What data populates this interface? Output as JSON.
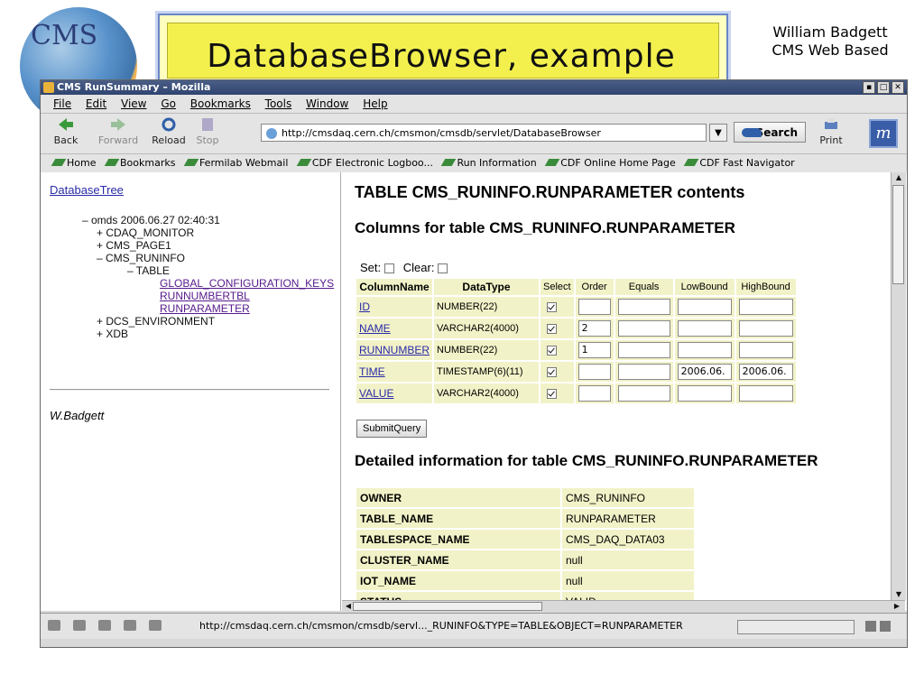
{
  "slide": {
    "title": "DatabaseBrowser, example",
    "author_line1": "William Badgett",
    "author_line2": "CMS Web Based",
    "logo_text": "CMS"
  },
  "window": {
    "title": "CMS RunSummary – Mozilla",
    "menu": [
      "File",
      "Edit",
      "View",
      "Go",
      "Bookmarks",
      "Tools",
      "Window",
      "Help"
    ],
    "nav": {
      "back": "Back",
      "forward": "Forward",
      "reload": "Reload",
      "stop": "Stop",
      "search": "Search",
      "print": "Print"
    },
    "url": "http://cmsdaq.cern.ch/cmsmon/cmsdb/servlet/DatabaseBrowser",
    "bookmarks": [
      "Home",
      "Bookmarks",
      "Fermilab Webmail",
      "CDF Electronic Logboo...",
      "Run Information",
      "CDF Online Home Page",
      "CDF Fast Navigator"
    ],
    "status_url": "http://cmsdaq.cern.ch/cmsmon/cmsdb/servl..._RUNINFO&TYPE=TABLE&OBJECT=RUNPARAMETER"
  },
  "left": {
    "tree_link": "DatabaseTree",
    "tree": {
      "root": "– omds 2006.06.27 02:40:31",
      "n1": "+ CDAQ_MONITOR",
      "n2": "+ CMS_PAGE1",
      "n3": "– CMS_RUNINFO",
      "n4": "– TABLE",
      "l1": "GLOBAL_CONFIGURATION_KEYS",
      "l2": "RUNNUMBERTBL",
      "l3": "RUNPARAMETER",
      "n5": "+ DCS_ENVIRONMENT",
      "n6": "+ XDB"
    },
    "signature": "W.Badgett"
  },
  "main": {
    "heading": "TABLE CMS_RUNINFO.RUNPARAMETER contents",
    "columns_heading": "Columns for table CMS_RUNINFO.RUNPARAMETER",
    "set_label": "Set:",
    "clear_label": "Clear:",
    "headers": [
      "ColumnName",
      "DataType",
      "Select",
      "Order",
      "Equals",
      "LowBound",
      "HighBound"
    ],
    "rows": [
      {
        "name": "ID",
        "type": "NUMBER(22)",
        "order": "",
        "equals": "",
        "low": "",
        "high": ""
      },
      {
        "name": "NAME",
        "type": "VARCHAR2(4000)",
        "order": "2",
        "equals": "",
        "low": "",
        "high": ""
      },
      {
        "name": "RUNNUMBER",
        "type": "NUMBER(22)",
        "order": "1",
        "equals": "",
        "low": "",
        "high": ""
      },
      {
        "name": "TIME",
        "type": "TIMESTAMP(6)(11)",
        "order": "",
        "equals": "",
        "low": "2006.06.",
        "high": "2006.06."
      },
      {
        "name": "VALUE",
        "type": "VARCHAR2(4000)",
        "order": "",
        "equals": "",
        "low": "",
        "high": ""
      }
    ],
    "submit": "SubmitQuery",
    "detail_heading": "Detailed information for table CMS_RUNINFO.RUNPARAMETER",
    "details": [
      {
        "k": "OWNER",
        "v": "CMS_RUNINFO"
      },
      {
        "k": "TABLE_NAME",
        "v": "RUNPARAMETER"
      },
      {
        "k": "TABLESPACE_NAME",
        "v": "CMS_DAQ_DATA03"
      },
      {
        "k": "CLUSTER_NAME",
        "v": "null"
      },
      {
        "k": "IOT_NAME",
        "v": "null"
      },
      {
        "k": "STATUS",
        "v": "VALID"
      }
    ]
  },
  "colors": {
    "title_bg": "#f3f04e",
    "cell_bg": "#f2f2c8",
    "link": "#2a2aa8",
    "visited": "#551a8b"
  }
}
